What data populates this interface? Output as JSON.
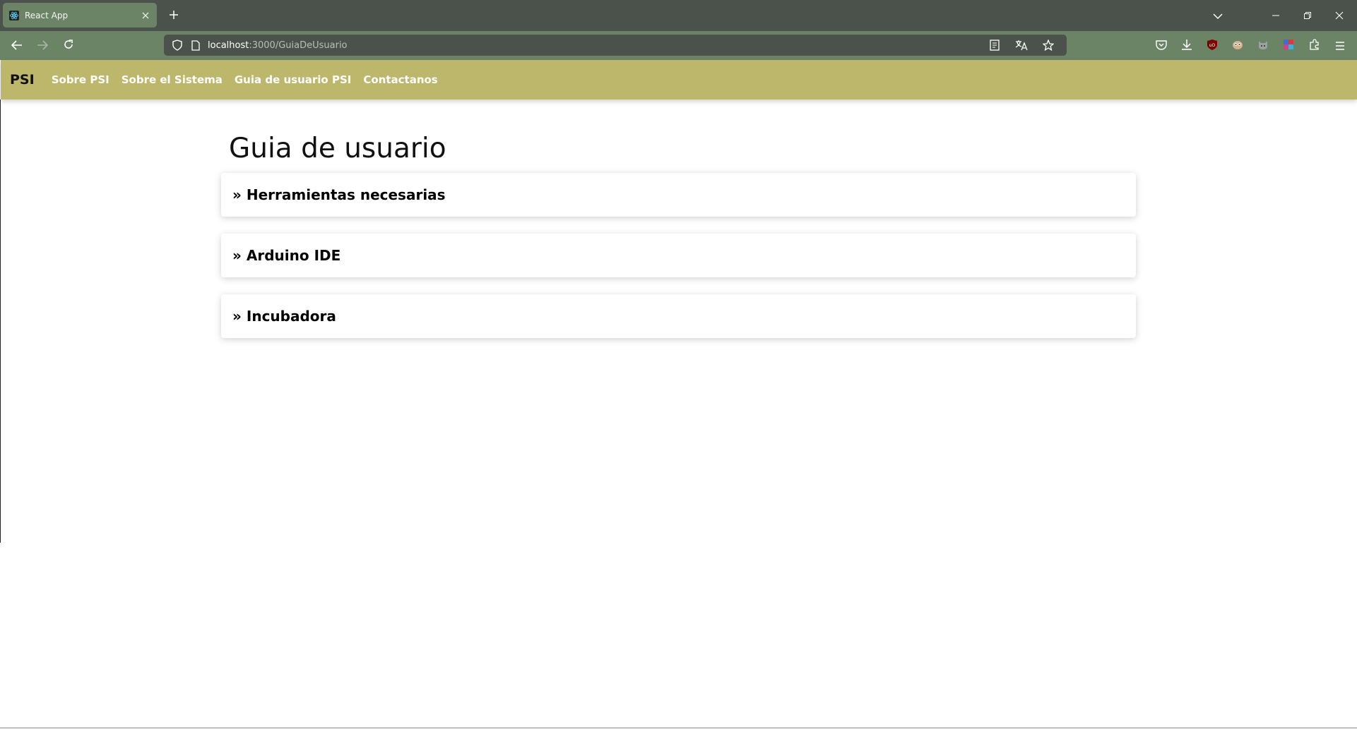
{
  "browser": {
    "tab_title": "React App",
    "url_host": "localhost",
    "url_path": ":3000/GuiaDeUsuario",
    "icons": {
      "favicon": "react-logo-icon",
      "close": "close-icon",
      "new_tab": "plus-icon",
      "list_tabs": "chevron-down-icon",
      "minimize": "minimize-icon",
      "restore": "restore-icon",
      "close_window": "close-icon",
      "back": "arrow-left-icon",
      "forward": "arrow-right-icon",
      "reload": "reload-icon",
      "shield": "shield-icon",
      "page": "page-icon",
      "reader": "reader-view-icon",
      "translate": "translate-icon",
      "bookmark": "star-icon",
      "pocket": "pocket-icon",
      "downloads": "download-icon",
      "ublock": "ublock-icon",
      "ext_face": "extension-face-icon",
      "ext_cat": "extension-cat-icon",
      "ext_flag": "extension-flag-icon",
      "extensions": "puzzle-icon",
      "menu": "hamburger-menu-icon"
    }
  },
  "app_nav": {
    "brand": "PSI",
    "links": [
      "Sobre PSI",
      "Sobre el Sistema",
      "Guia de usuario PSI",
      "Contactanos"
    ]
  },
  "main": {
    "title": "Guia de usuario",
    "sections": [
      {
        "title": "» Herramientas necesarias"
      },
      {
        "title": "» Arduino IDE"
      },
      {
        "title": "» Incubadora"
      }
    ]
  },
  "colors": {
    "tabbar_bg": "#4b524b",
    "browser_toolbar_bg": "#6b8466",
    "app_nav_bg": "#bdb76b",
    "nav_link": "#ffffff"
  }
}
